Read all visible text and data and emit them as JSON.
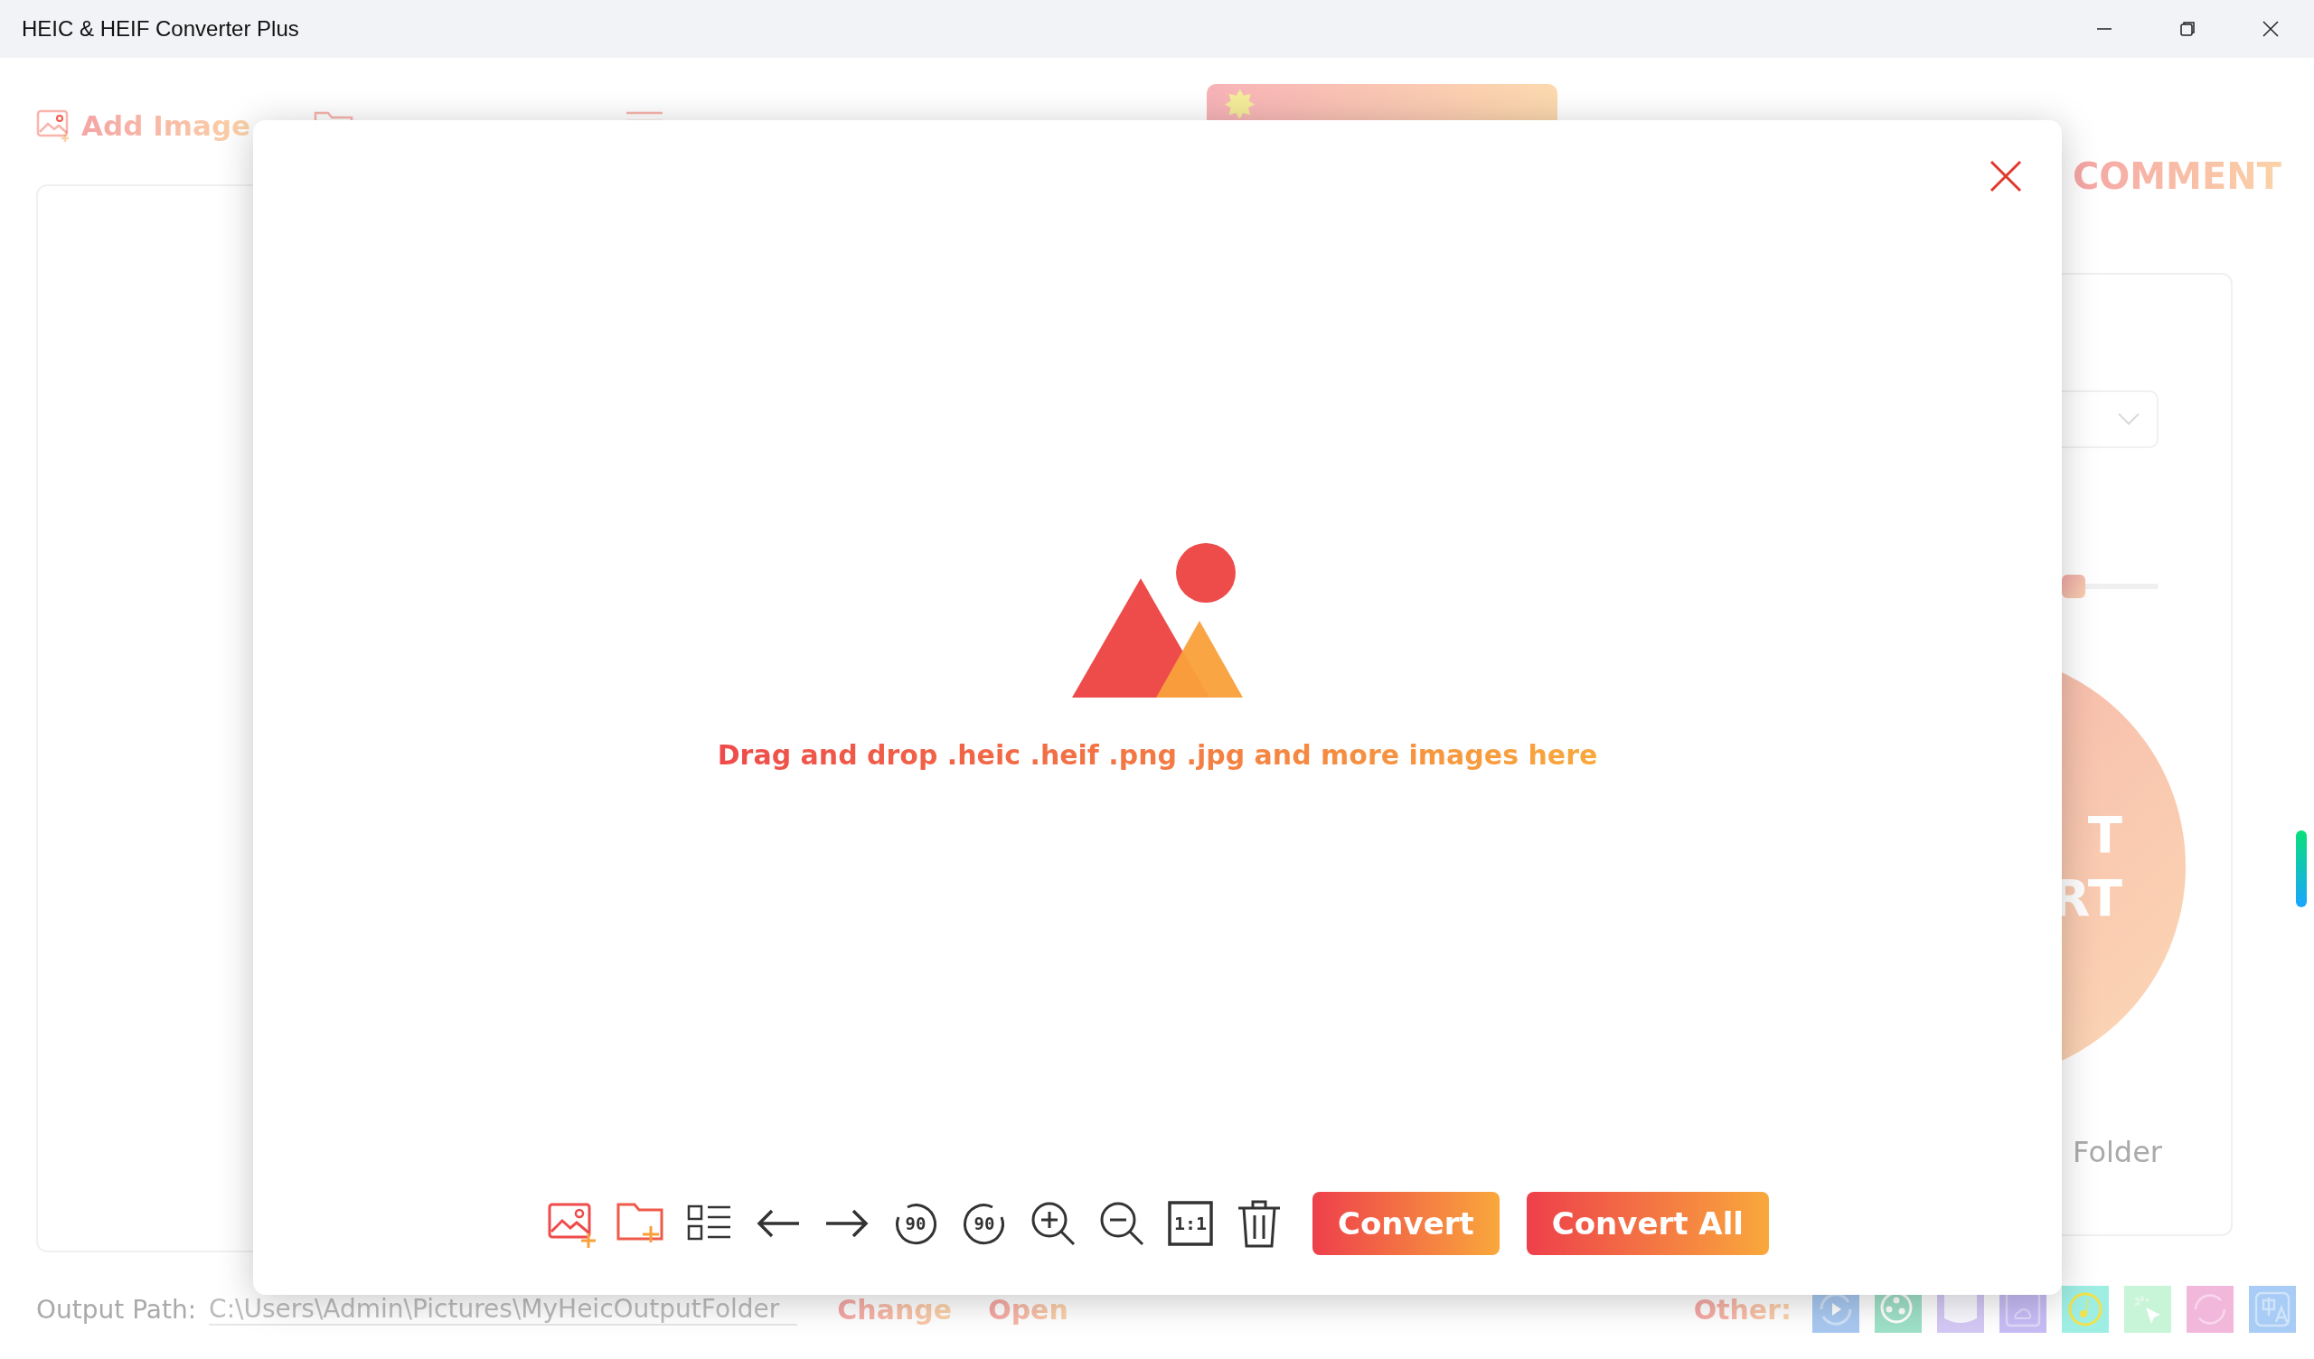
{
  "window": {
    "title": "HEIC & HEIF Converter Plus"
  },
  "toolbar": {
    "add_image": "Add Image"
  },
  "settings_panel": {
    "heading": "COMMENT",
    "slider": {
      "level": 0.75
    },
    "circle_lines": [
      "T",
      "RT"
    ],
    "folder_label": "Folder"
  },
  "output": {
    "label": "Output Path:",
    "path": "C:\\Users\\Admin\\Pictures\\MyHeicOutputFolder",
    "actions": [
      "Change",
      "Open"
    ]
  },
  "other": {
    "label": "Other:",
    "apps": [
      {
        "kind": "video",
        "color": "#a8c8f0"
      },
      {
        "kind": "dvd",
        "color": "#9ee0c8"
      },
      {
        "kind": "iptv",
        "color": "#d4c8f5"
      },
      {
        "kind": "tube",
        "color": "#c8bcf5"
      },
      {
        "kind": "music",
        "color": "#9eeee4"
      },
      {
        "kind": "cursor",
        "color": "#c8f5d8"
      },
      {
        "kind": "icon",
        "color": "#f2b8dc"
      },
      {
        "kind": "translate",
        "color": "#a8ccf5"
      }
    ]
  },
  "modal": {
    "drop_text": "Drag and drop .heic .heif .png .jpg and more images here",
    "tools": [
      {
        "kind": "add_image"
      },
      {
        "kind": "add_folder"
      },
      {
        "kind": "list"
      },
      {
        "kind": "previous"
      },
      {
        "kind": "next"
      },
      {
        "kind": "rotate_left",
        "label": "90"
      },
      {
        "kind": "rotate_right",
        "label": "90"
      },
      {
        "kind": "zoom_in"
      },
      {
        "kind": "zoom_out"
      },
      {
        "kind": "actual_size",
        "label": "1:1"
      },
      {
        "kind": "delete"
      }
    ],
    "buttons": [
      "Convert",
      "Convert All"
    ]
  }
}
